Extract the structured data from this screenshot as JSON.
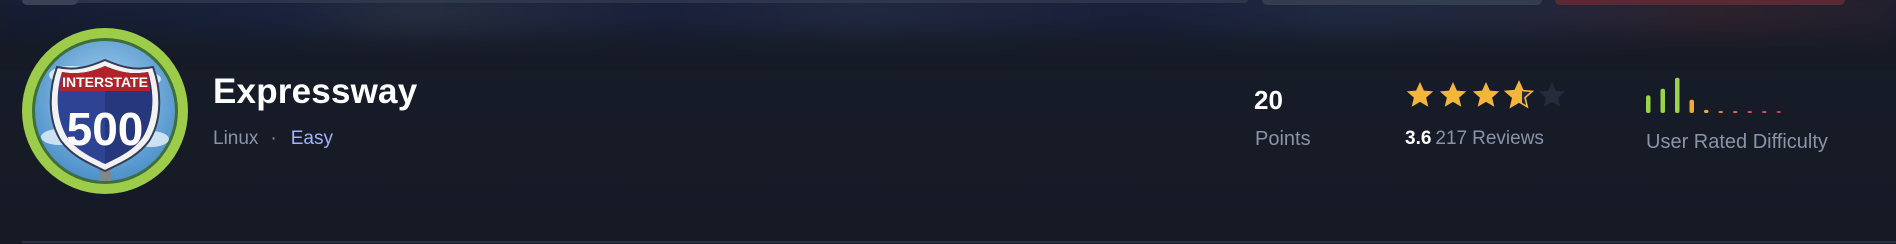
{
  "machine": {
    "name": "Expressway",
    "os": "Linux",
    "separator": "·",
    "difficulty": "Easy",
    "logo": {
      "sign_top_text": "INTERSTATE",
      "sign_number": "500",
      "icon": "interstate-sign-icon",
      "ring_color": "#9ccc4a"
    }
  },
  "stats": {
    "points_value": "20",
    "points_label": "Points",
    "rating_value": "3.6",
    "rating_count": "217",
    "rating_label": "Reviews",
    "stars_filled": 3.6,
    "stars_total": 5,
    "star_color": "#f4b63a",
    "star_empty_color": "#252b3a"
  },
  "user_difficulty": {
    "label": "User Rated Difficulty",
    "bars": [
      0.4,
      0.55,
      0.8,
      0.3,
      0.07,
      0.03,
      0.03,
      0.03,
      0.03,
      0.03
    ],
    "bar_colors": [
      "#9bd34a",
      "#9bd34a",
      "#9bd34a",
      "#f0a936",
      "#f0a936",
      "#e88a3b",
      "#e06a3f",
      "#d9544a",
      "#d9544a",
      "#c94050"
    ]
  },
  "theme": {
    "accent": "#9fb3ff",
    "background": "#161b27"
  }
}
